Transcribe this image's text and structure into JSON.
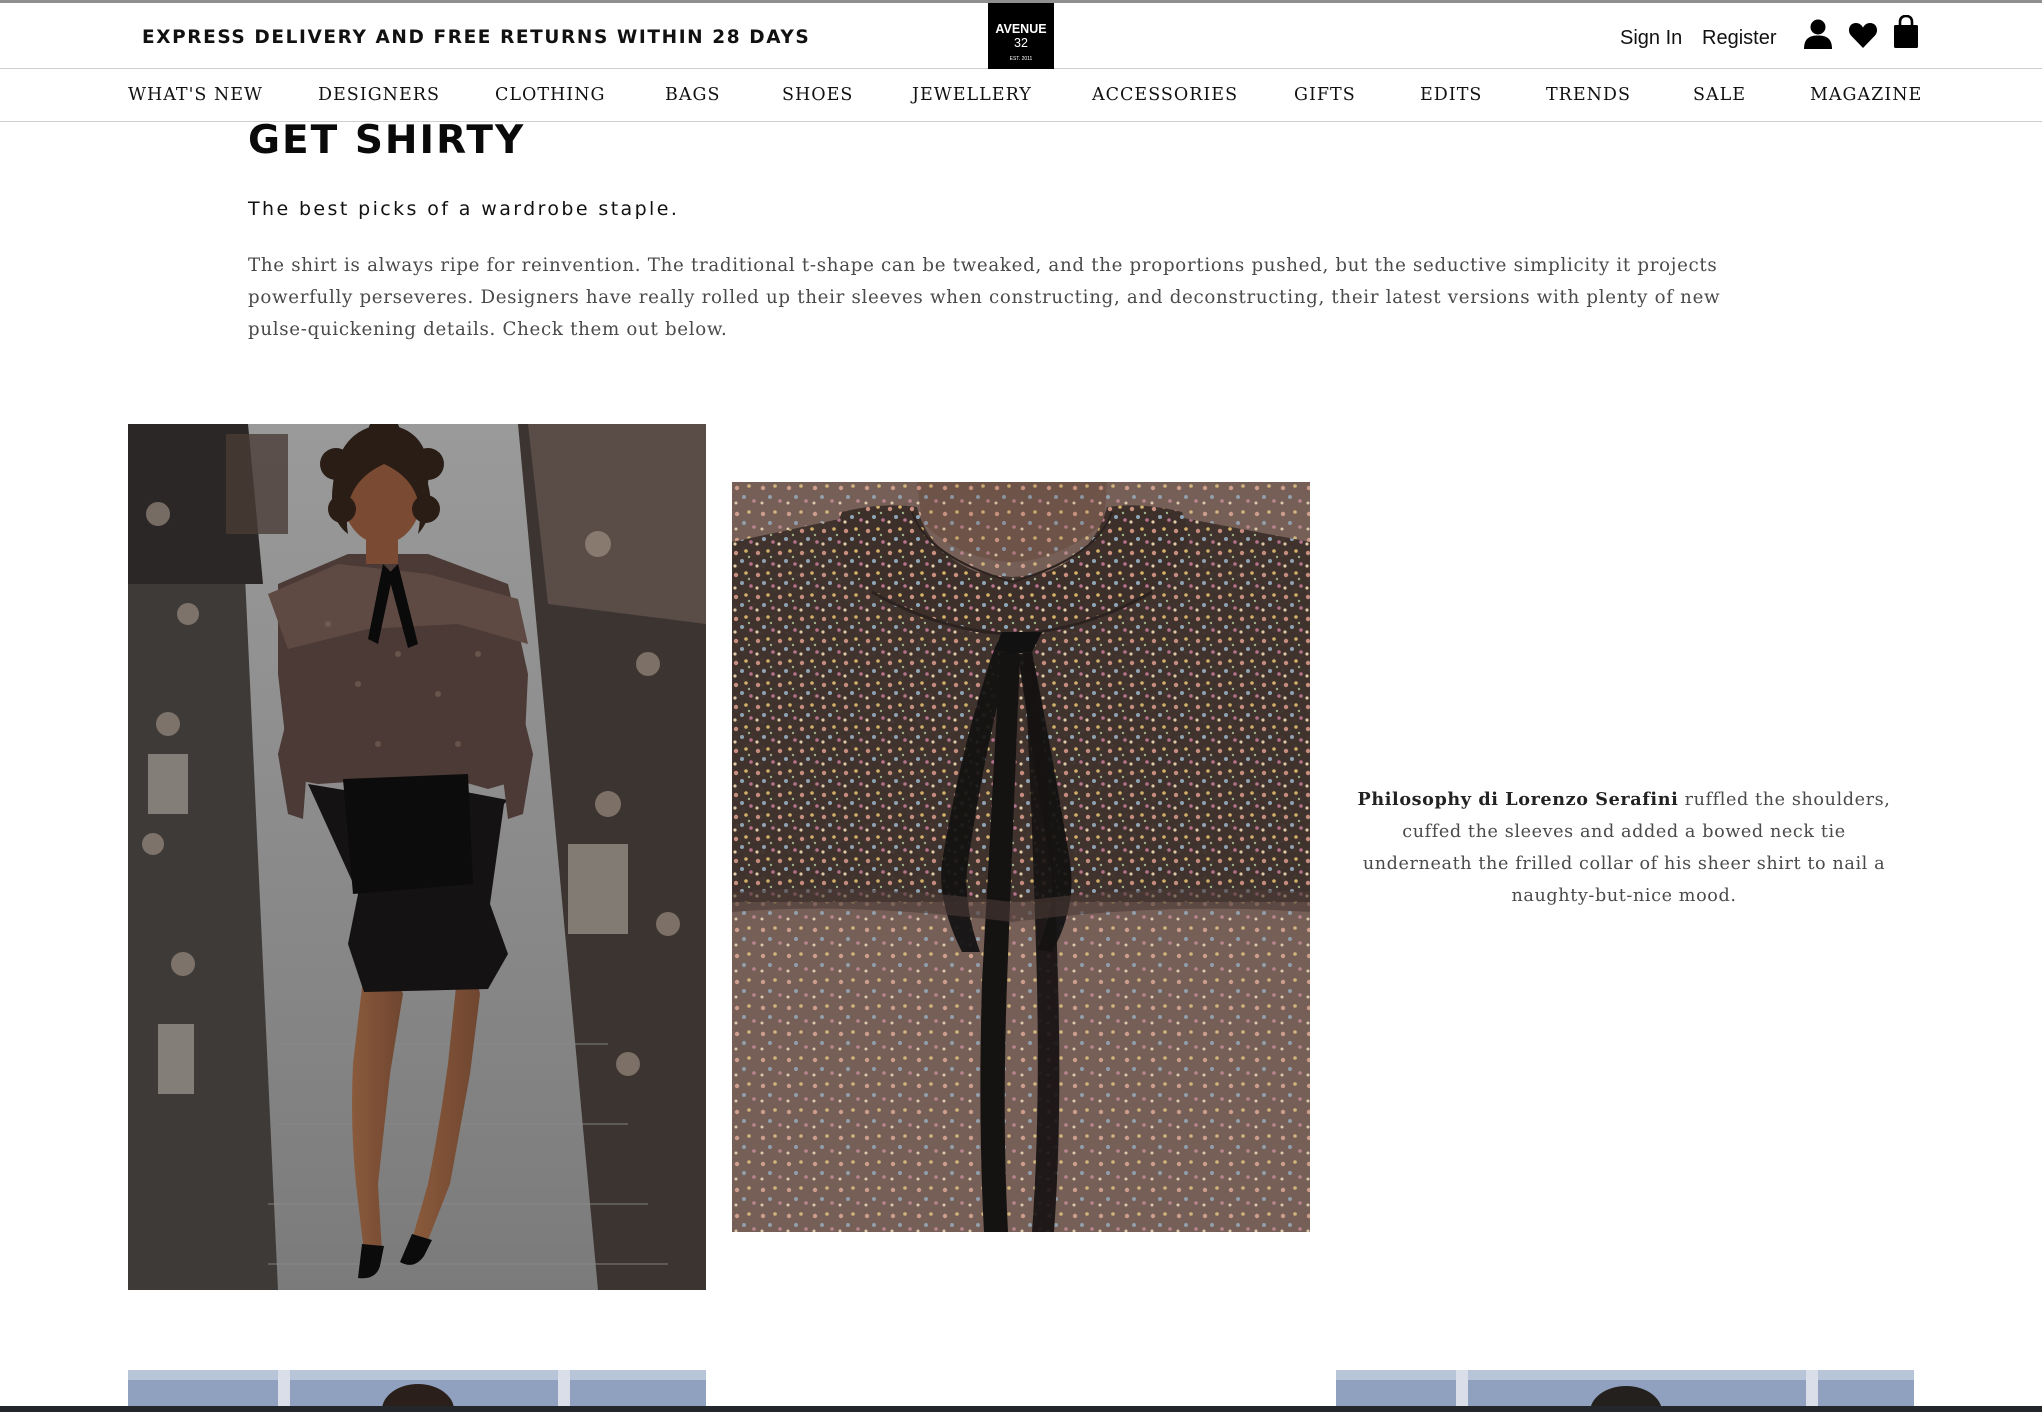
{
  "header": {
    "promo": "EXPRESS DELIVERY AND FREE RETURNS WITHIN 28 DAYS",
    "logo": {
      "line1": "AVENUE",
      "line2": "32",
      "line3": "EST. 2011"
    },
    "sign_in": "Sign In",
    "register": "Register",
    "icons": [
      "user-icon",
      "heart-icon",
      "shopping-bag-icon"
    ]
  },
  "nav": {
    "items": [
      "WHAT'S NEW",
      "DESIGNERS",
      "CLOTHING",
      "BAGS",
      "SHOES",
      "JEWELLERY",
      "ACCESSORIES",
      "GIFTS",
      "EDITS",
      "TRENDS",
      "SALE",
      "MAGAZINE"
    ]
  },
  "article": {
    "title": "GET SHIRTY",
    "subtitle": "The best picks of a wardrobe staple.",
    "intro": "The shirt is always ripe for reinvention. The traditional t-shape can be tweaked, and the proportions pushed, but the seductive simplicity it projects powerfully perseveres. Designers have really rolled up their sleeves when constructing, and deconstructing, their latest versions with plenty of new pulse-quickening details. Check them out below.",
    "feature": {
      "designer": "Philosophy di Lorenzo Serafini",
      "caption": " ruffled the shoulders, cuffed the sleeves and added a bowed neck tie underneath the frilled collar of his sheer shirt to nail a naughty-but-nice mood."
    }
  },
  "colors": {
    "text": "#111111",
    "body_text": "#4a4a4a",
    "divider": "#cfcfcf",
    "logo_bg": "#000000"
  }
}
